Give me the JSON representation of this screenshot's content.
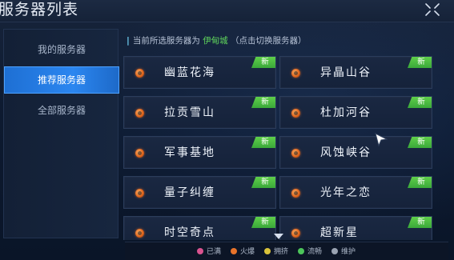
{
  "window": {
    "title": "服务器列表"
  },
  "sidebar": {
    "items": [
      {
        "label": "我的服务器",
        "active": false
      },
      {
        "label": "推荐服务器",
        "active": true
      },
      {
        "label": "全部服务器",
        "active": false
      }
    ]
  },
  "current_server": {
    "prefix": "当前所选服务器为",
    "name": "伊甸城",
    "hint": "（点击切换服务器）"
  },
  "servers": [
    {
      "name": "幽蓝花海",
      "badge": "新",
      "status": "火爆"
    },
    {
      "name": "异晶山谷",
      "badge": "新",
      "status": "火爆"
    },
    {
      "name": "拉贡雪山",
      "badge": "新",
      "status": "火爆"
    },
    {
      "name": "杜加河谷",
      "badge": "新",
      "status": "火爆"
    },
    {
      "name": "军事基地",
      "badge": "新",
      "status": "火爆"
    },
    {
      "name": "风蚀峡谷",
      "badge": "新",
      "status": "火爆"
    },
    {
      "name": "量子纠缠",
      "badge": "新",
      "status": "火爆"
    },
    {
      "name": "光年之恋",
      "badge": "新",
      "status": "火爆"
    },
    {
      "name": "时空奇点",
      "badge": "新",
      "status": "火爆"
    },
    {
      "name": "超新星",
      "badge": "新",
      "status": "火爆"
    }
  ],
  "legend": [
    {
      "label": "已满",
      "color": "#d9538f"
    },
    {
      "label": "火爆",
      "color": "#e8732a"
    },
    {
      "label": "拥挤",
      "color": "#d9c23a"
    },
    {
      "label": "流畅",
      "color": "#4cc45a"
    },
    {
      "label": "维护",
      "color": "#9aa3b2"
    }
  ],
  "colors": {
    "accent": "#2b86f0",
    "new_badge": "#4cbf44",
    "highlight": "#5fd35b"
  }
}
